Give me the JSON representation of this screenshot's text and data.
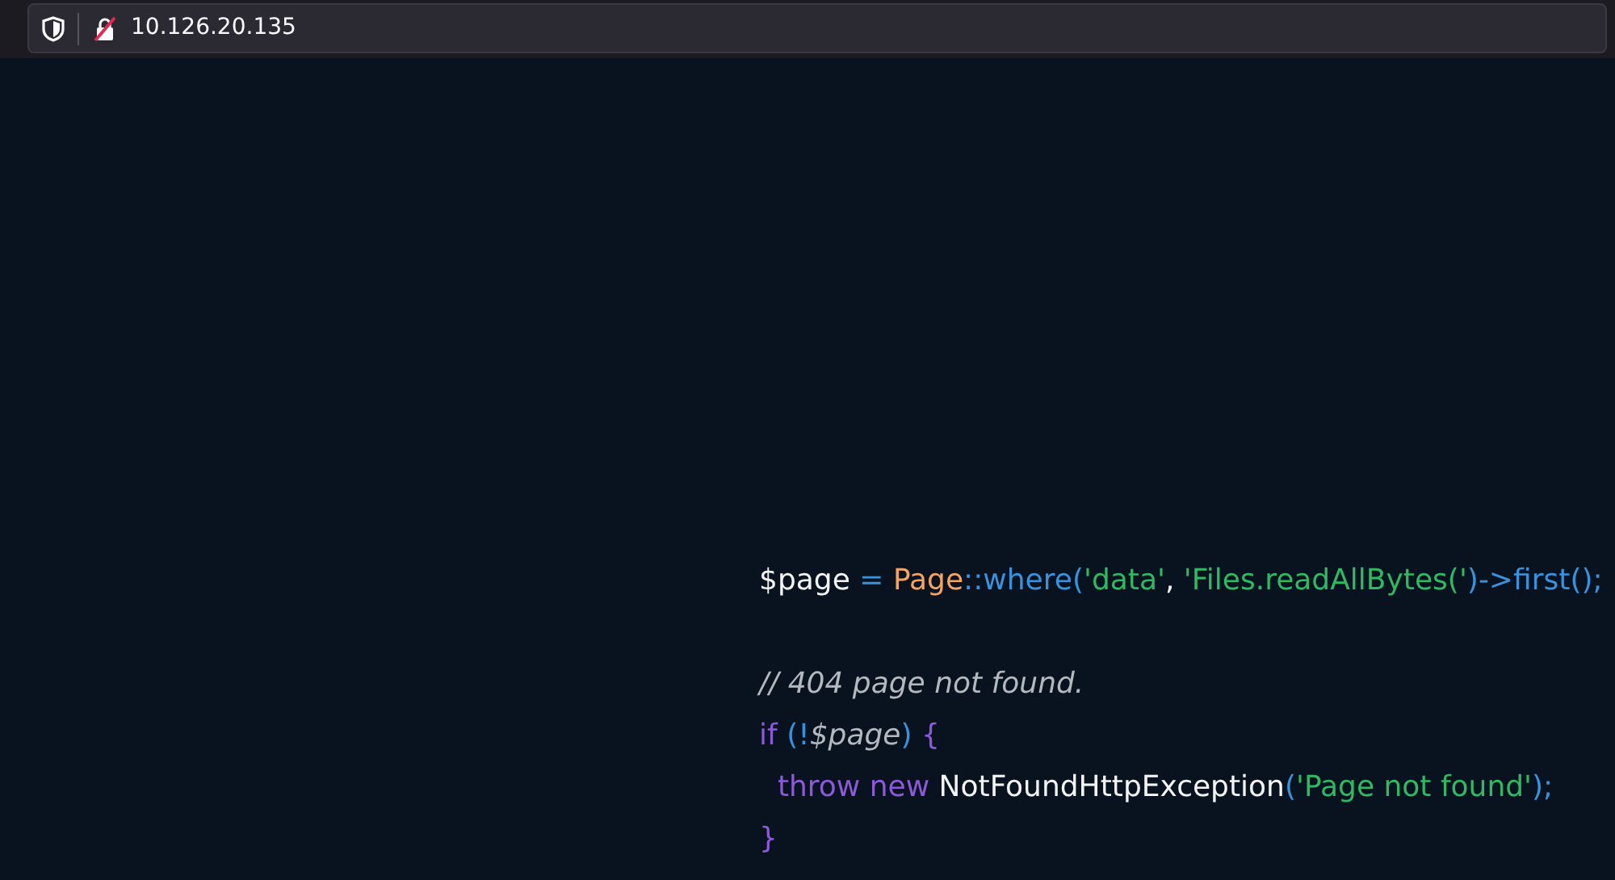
{
  "address_bar": {
    "url": "10.126.20.135",
    "insecure": true
  },
  "code": {
    "lines": [
      {
        "blank_before": false,
        "tokens": [
          {
            "text": "$page",
            "kind": "plain"
          },
          {
            "text": " = ",
            "kind": "operator"
          },
          {
            "text": "Page",
            "kind": "class"
          },
          {
            "text": "::",
            "kind": "operator"
          },
          {
            "text": "where",
            "kind": "method"
          },
          {
            "text": "(",
            "kind": "punct"
          },
          {
            "text": "'data'",
            "kind": "string"
          },
          {
            "text": ", ",
            "kind": "plain"
          },
          {
            "text": "'Files.readAllBytes('",
            "kind": "string"
          },
          {
            "text": ")",
            "kind": "punct"
          },
          {
            "text": "->",
            "kind": "operator"
          },
          {
            "text": "first",
            "kind": "method"
          },
          {
            "text": "();",
            "kind": "punct"
          }
        ]
      },
      {
        "blank_before": true,
        "tokens": [
          {
            "text": "// 404 page not found.",
            "kind": "comment"
          }
        ]
      },
      {
        "blank_before": false,
        "tokens": [
          {
            "text": "if",
            "kind": "keyword"
          },
          {
            "text": " (!",
            "kind": "punct"
          },
          {
            "text": "$page",
            "kind": "variable"
          },
          {
            "text": ")",
            "kind": "punct"
          },
          {
            "text": " {",
            "kind": "keyword"
          }
        ]
      },
      {
        "blank_before": false,
        "tokens": [
          {
            "text": "  throw new ",
            "kind": "keyword"
          },
          {
            "text": "NotFoundHttpException",
            "kind": "plain"
          },
          {
            "text": "(",
            "kind": "punct"
          },
          {
            "text": "'Page not found'",
            "kind": "string"
          },
          {
            "text": ");",
            "kind": "punct"
          }
        ]
      },
      {
        "blank_before": false,
        "tokens": [
          {
            "text": "}",
            "kind": "keyword"
          }
        ]
      }
    ]
  }
}
